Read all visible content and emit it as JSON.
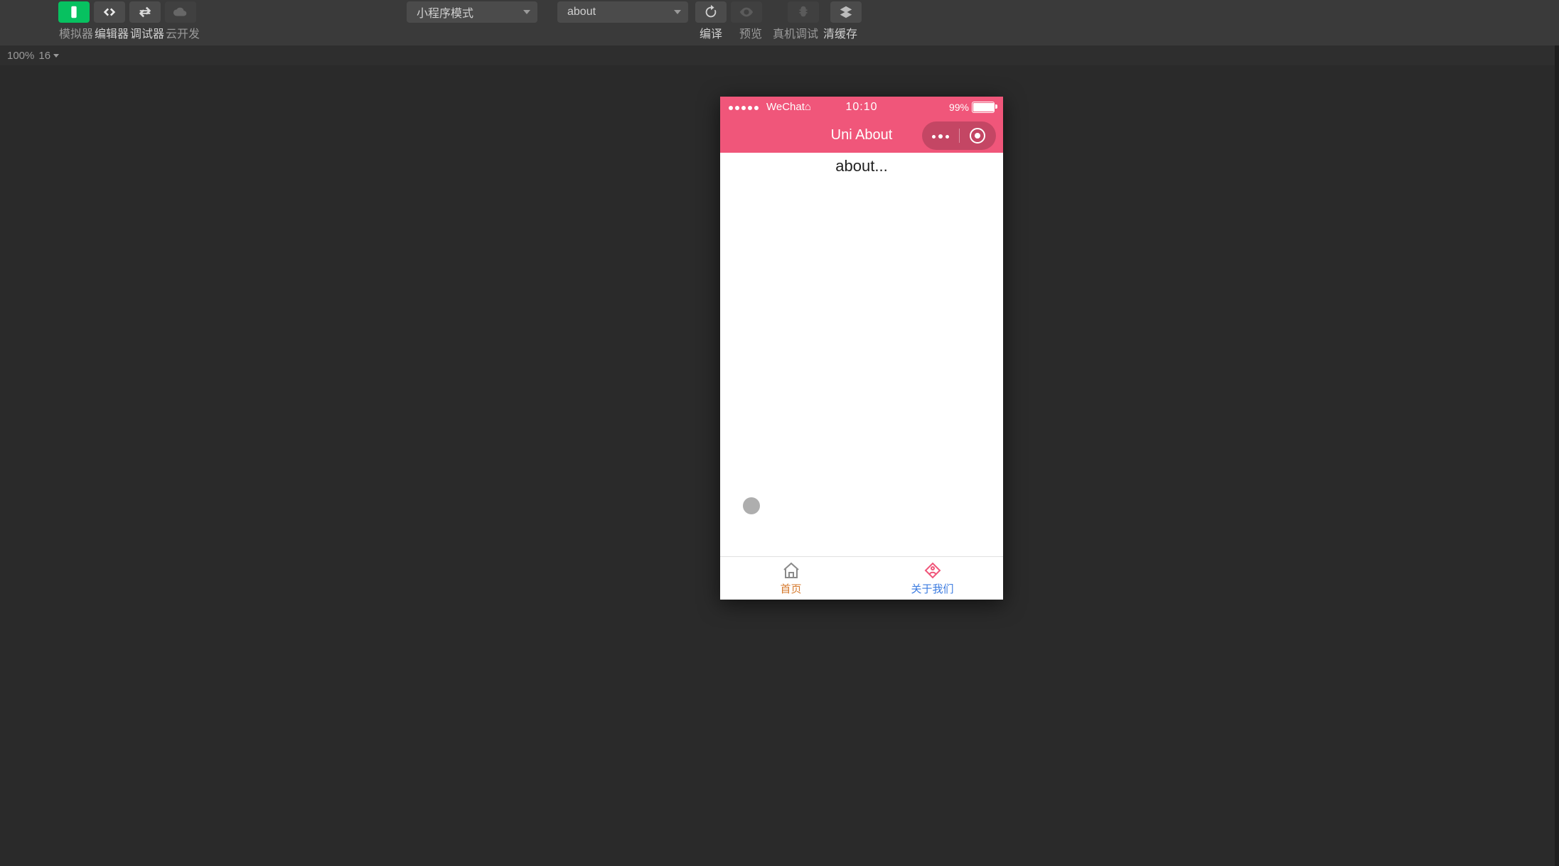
{
  "toolbar": {
    "tabs": {
      "simulator": "模拟器",
      "editor": "编辑器",
      "debugger": "调试器",
      "cloud": "云开发"
    },
    "mode_select": "小程序模式",
    "page_select": "about",
    "actions": {
      "compile": "编译",
      "preview": "预览",
      "remote": "真机调试",
      "clearcache": "清缓存"
    }
  },
  "zoom": {
    "percent": "100%",
    "fontsize": "16"
  },
  "phone": {
    "status": {
      "carrier": "WeChat",
      "time": "10:10",
      "battery": "99%"
    },
    "nav": {
      "title": "Uni About"
    },
    "body": {
      "text": "about..."
    },
    "tabs": {
      "home": "首页",
      "about": "关于我们"
    }
  }
}
